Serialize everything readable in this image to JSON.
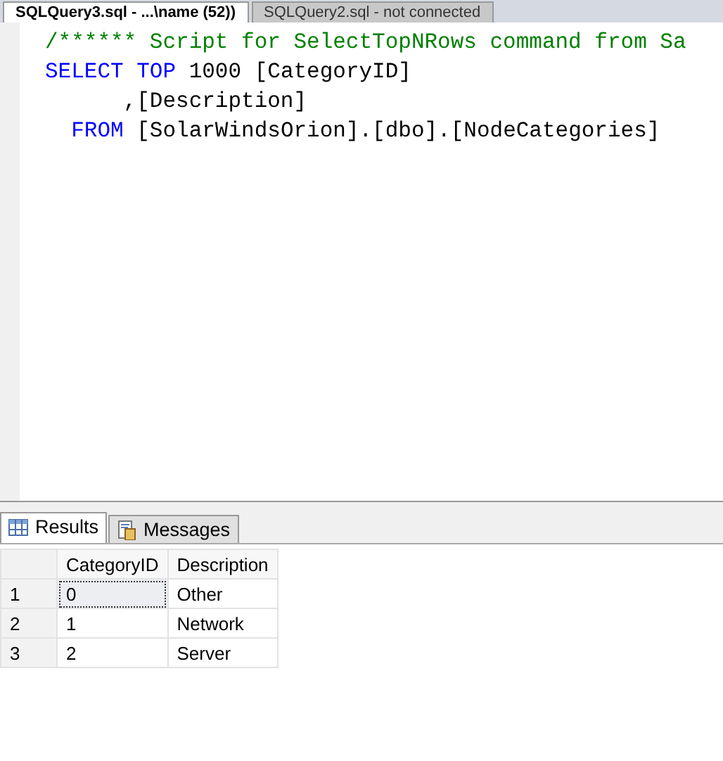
{
  "document_tabs": [
    {
      "label": "SQLQuery3.sql - ...\\name (52))",
      "selected": true
    },
    {
      "label": "SQLQuery2.sql - not connected",
      "selected": false
    }
  ],
  "editor": {
    "lines": [
      [
        {
          "kind": "comment",
          "text": "/****** Script for SelectTopNRows command from Sa"
        }
      ],
      [
        {
          "kind": "keyword",
          "text": "SELECT TOP "
        },
        {
          "kind": "plain",
          "text": "1000 [CategoryID]"
        }
      ],
      [
        {
          "kind": "plain",
          "text": "      ,[Description]"
        }
      ],
      [
        {
          "kind": "keyword",
          "text": "  FROM "
        },
        {
          "kind": "plain",
          "text": "[SolarWindsOrion].[dbo].[NodeCategories]"
        }
      ]
    ]
  },
  "result_tabs": [
    {
      "label": "Results",
      "kind": "grid",
      "selected": true
    },
    {
      "label": "Messages",
      "kind": "messages",
      "selected": false
    }
  ],
  "table": {
    "columns": [
      "CategoryID",
      "Description"
    ],
    "rows": [
      {
        "number": "1",
        "cells": [
          "0",
          "Other"
        ],
        "focused": true
      },
      {
        "number": "2",
        "cells": [
          "1",
          "Network"
        ],
        "focused": false
      },
      {
        "number": "3",
        "cells": [
          "2",
          "Server"
        ],
        "focused": false
      }
    ]
  }
}
